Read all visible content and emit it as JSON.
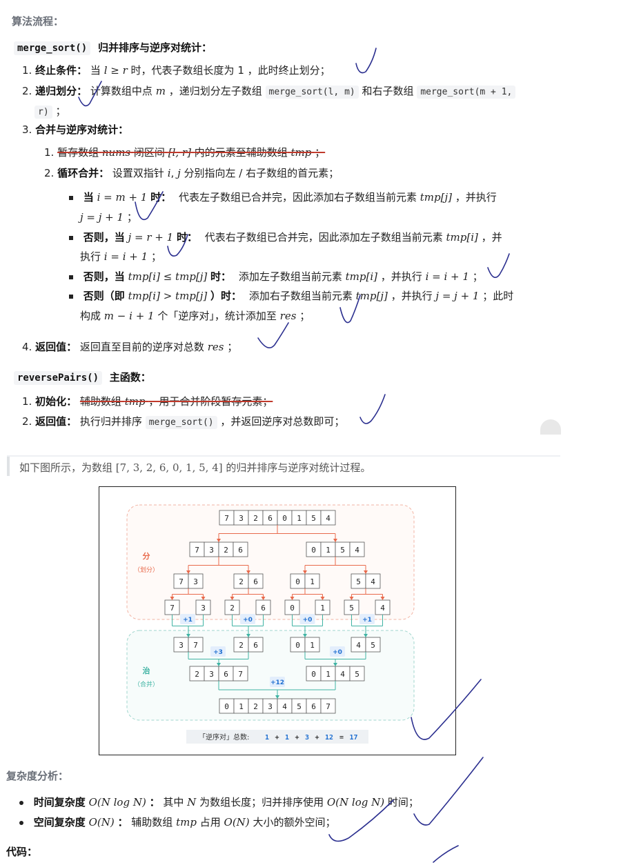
{
  "heading_algo": "算法流程：",
  "merge_sort_head": {
    "code": "merge_sort()",
    "title": "归并排序与逆序对统计："
  },
  "step1": {
    "num": "1.",
    "label": "终止条件：",
    "pre": "当",
    "cond": "l ≥ r",
    "post": "时，代表子数组长度为 1 ，此时终止划分；"
  },
  "step2": {
    "num": "2.",
    "label": "递归划分：",
    "pre": "计算数组中点",
    "var": "m",
    "mid": "，递归划分左子数组",
    "code1": "merge_sort(l, m)",
    "mid2": "和右子数组",
    "code2a": "merge_sort(m + 1,",
    "code2b": "r)",
    "post": "；"
  },
  "step3": {
    "num": "3.",
    "label": "合并与逆序对统计："
  },
  "step3_1": {
    "num": "1.",
    "t1": "暂存数组",
    "v1": "nums",
    "t2": "闭区间",
    "v2": "[l, r]",
    "t3": "内的元素至辅助数组",
    "v3": "tmp",
    "t4": "；"
  },
  "step3_2": {
    "num": "2.",
    "label": "循环合并：",
    "t1": "设置双指针",
    "v1": "i",
    "t2": ",",
    "v2": "j",
    "t3": "分别指向左 / 右子数组的首元素；"
  },
  "b1": {
    "lead": "当",
    "cond": "i = m + 1",
    "lead2": "时：",
    "t1": "代表左子数组已合并完，因此添加右子数组当前元素",
    "v1": "tmp[j]",
    "t2": "，并执行",
    "line2": "j = j + 1",
    "t3": "；"
  },
  "b2": {
    "lead": "否则，当",
    "cond": "j = r + 1",
    "lead2": "时：",
    "t1": "代表右子数组已合并完，因此添加左子数组当前元素",
    "v1": "tmp[i]",
    "t2": "，并",
    "t3": "执行",
    "line2": "i = i + 1",
    "t4": "；"
  },
  "b3": {
    "lead": "否则，当",
    "cond": "tmp[i] ≤ tmp[j]",
    "lead2": "时：",
    "t1": "添加左子数组当前元素",
    "v1": "tmp[i]",
    "t2": "，并执行",
    "v2": "i = i + 1",
    "t3": "；"
  },
  "b4": {
    "lead": "否则（即",
    "cond": "tmp[i] > tmp[j]",
    "lead2": "）时：",
    "t1": "添加右子数组当前元素",
    "v1": "tmp[j]",
    "t2": "，并执行",
    "v2": "j = j + 1",
    "t3": "；此时",
    "t4": "构成",
    "v3": "m − i + 1",
    "t5": "个「逆序对」，统计添加至",
    "v4": "res",
    "t6": "；"
  },
  "step4": {
    "num": "4.",
    "label": "返回值：",
    "t1": "返回直至目前的逆序对总数",
    "v1": "res",
    "t2": "；"
  },
  "reverse_head": {
    "code": "reversePairs()",
    "title": "主函数："
  },
  "r1": {
    "num": "1.",
    "label": "初始化：",
    "t1": "辅助数组",
    "v1": "tmp",
    "t2": "，用于合并阶段暂存元素；"
  },
  "r2": {
    "num": "2.",
    "label": "返回值：",
    "t1": "执行归并排序",
    "code": "merge_sort()",
    "t2": "，并返回逆序对总数即可；"
  },
  "quote": {
    "t1": "如下图所示，为数组",
    "arr": "[7, 3, 2, 6, 0, 1, 5, 4]",
    "t2": "的归并排序与逆序对统计过程。"
  },
  "figure": {
    "divide_label": "分",
    "divide_sub": "（划分）",
    "conquer_label": "治",
    "conquer_sub": "（合并）",
    "level0": [
      "7",
      "3",
      "2",
      "6",
      "0",
      "1",
      "5",
      "4"
    ],
    "level1": [
      [
        "7",
        "3",
        "2",
        "6"
      ],
      [
        "0",
        "1",
        "5",
        "4"
      ]
    ],
    "level2": [
      [
        "7",
        "3"
      ],
      [
        "2",
        "6"
      ],
      [
        "0",
        "1"
      ],
      [
        "5",
        "4"
      ]
    ],
    "level3": [
      "7",
      "3",
      "2",
      "6",
      "0",
      "1",
      "5",
      "4"
    ],
    "merge1": [
      [
        "3",
        "7"
      ],
      [
        "2",
        "6"
      ],
      [
        "0",
        "1"
      ],
      [
        "4",
        "5"
      ]
    ],
    "merge2": [
      [
        "2",
        "3",
        "6",
        "7"
      ],
      [
        "0",
        "1",
        "4",
        "5"
      ]
    ],
    "merge3": [
      "0",
      "1",
      "2",
      "3",
      "4",
      "5",
      "6",
      "7"
    ],
    "counts_l1": [
      "+1",
      "+0",
      "+0",
      "+1"
    ],
    "counts_l2": [
      "+3",
      "+0"
    ],
    "counts_l3": [
      "+12"
    ],
    "total_label": "「逆序对」总数:",
    "total_expr": [
      "1",
      "+",
      "1",
      "+",
      "3",
      "+",
      "12",
      "=",
      "17"
    ],
    "colors": {
      "divide": "#e8694b",
      "conquer": "#3fb3a3",
      "count": "#1f6fd1"
    }
  },
  "complexity": {
    "heading": "复杂度分析：",
    "time": {
      "label": "时间复杂度",
      "expr": "O(N log N)",
      "colon": "：",
      "t1": "其中",
      "v1": "N",
      "t2": "为数组长度；归并排序使用",
      "v2": "O(N log N)",
      "t3": "时间；"
    },
    "space": {
      "label": "空间复杂度",
      "expr": "O(N)",
      "colon": "：",
      "t1": "辅助数组",
      "v1": "tmp",
      "t2": "占用",
      "v2": "O(N)",
      "t3": "大小的额外空间；"
    }
  },
  "code_heading": "代码：",
  "ink_color": "#2b2f8f"
}
